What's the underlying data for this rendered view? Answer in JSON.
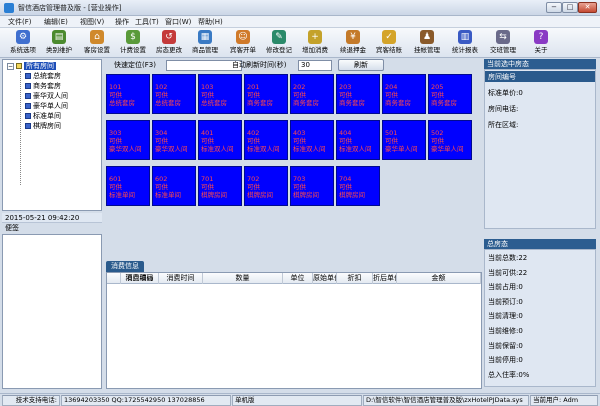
{
  "window": {
    "title": "智信酒店管理普及版 - [营业操作]",
    "controls": {
      "minimize": "−",
      "maximize": "□",
      "close": "✕"
    }
  },
  "menu": [
    "文件(F)",
    "编辑(E)",
    "视图(V)",
    "操作",
    "工具(T)",
    "窗口(W)",
    "帮助(H)"
  ],
  "toolbar": [
    {
      "label": "系统选项",
      "icon": "settings-icon",
      "color": "#3f6fcf",
      "glyph": "⚙"
    },
    {
      "label": "类别维护",
      "icon": "category-icon",
      "color": "#4b8a2e",
      "glyph": "▤"
    },
    {
      "label": "客房设置",
      "icon": "room-setup-icon",
      "color": "#d0892b",
      "glyph": "⌂"
    },
    {
      "label": "计费设置",
      "icon": "billing-icon",
      "color": "#5a9a3a",
      "glyph": "$"
    },
    {
      "label": "房态更改",
      "icon": "room-status-icon",
      "color": "#c43a3a",
      "glyph": "↺"
    },
    {
      "label": "商品管理",
      "icon": "goods-icon",
      "color": "#3a7ac4",
      "glyph": "▦"
    },
    {
      "label": "宾客开单",
      "icon": "checkin-icon",
      "color": "#d07a2a",
      "glyph": "☺"
    },
    {
      "label": "修改登记",
      "icon": "edit-register-icon",
      "color": "#2a8a6a",
      "glyph": "✎"
    },
    {
      "label": "增加消费",
      "icon": "add-consume-icon",
      "color": "#c4a22a",
      "glyph": "+"
    },
    {
      "label": "续退押金",
      "icon": "deposit-icon",
      "color": "#c47a2a",
      "glyph": "¥"
    },
    {
      "label": "宾客结账",
      "icon": "checkout-icon",
      "color": "#d4a42a",
      "glyph": "✓"
    },
    {
      "label": "挂帐管理",
      "icon": "credit-icon",
      "color": "#8a5a2a",
      "glyph": "♟"
    },
    {
      "label": "统计报表",
      "icon": "report-icon",
      "color": "#3a5ac4",
      "glyph": "▥"
    },
    {
      "label": "交班管理",
      "icon": "shift-icon",
      "color": "#6a6a8a",
      "glyph": "⇆"
    },
    {
      "label": "关于",
      "icon": "about-icon",
      "color": "#8a3ac4",
      "glyph": "?"
    }
  ],
  "tree": {
    "root": "所有房间",
    "children": [
      "总统套房",
      "商务套房",
      "豪华双人间",
      "豪华单人间",
      "标准单间",
      "棋牌房间"
    ]
  },
  "datetime": "2015-05-21  09:42:20",
  "memo": {
    "title": "便签"
  },
  "quick": {
    "locate_label": "快速定位(F3)",
    "locate_value": "",
    "refresh_label": "自动刷新时间(秒)",
    "refresh_value": "30",
    "refresh_button": "刷新"
  },
  "rooms": [
    {
      "no": "101",
      "status": "可供",
      "type": "总统套房"
    },
    {
      "no": "102",
      "status": "可供",
      "type": "总统套房"
    },
    {
      "no": "103",
      "status": "可供",
      "type": "总统套房"
    },
    {
      "no": "201",
      "status": "可供",
      "type": "商务套房"
    },
    {
      "no": "202",
      "status": "可供",
      "type": "商务套房"
    },
    {
      "no": "203",
      "status": "可供",
      "type": "商务套房"
    },
    {
      "no": "204",
      "status": "可供",
      "type": "商务套房"
    },
    {
      "no": "205",
      "status": "可供",
      "type": "商务套房"
    },
    {
      "no": "303",
      "status": "可供",
      "type": "豪华双人间"
    },
    {
      "no": "304",
      "status": "可供",
      "type": "豪华双人间"
    },
    {
      "no": "401",
      "status": "可供",
      "type": "标准双人间"
    },
    {
      "no": "402",
      "status": "可供",
      "type": "标准双人间"
    },
    {
      "no": "403",
      "status": "可供",
      "type": "标准双人间"
    },
    {
      "no": "404",
      "status": "可供",
      "type": "标准双人间"
    },
    {
      "no": "501",
      "status": "可供",
      "type": "豪华单人间"
    },
    {
      "no": "502",
      "status": "可供",
      "type": "豪华单人间"
    },
    {
      "no": "601",
      "status": "可供",
      "type": "标准单间"
    },
    {
      "no": "602",
      "status": "可供",
      "type": "标准单间"
    },
    {
      "no": "701",
      "status": "可供",
      "type": "棋牌房间"
    },
    {
      "no": "702",
      "status": "可供",
      "type": "棋牌房间"
    },
    {
      "no": "703",
      "status": "可供",
      "type": "棋牌房间"
    },
    {
      "no": "704",
      "status": "可供",
      "type": "棋牌房间"
    }
  ],
  "consume": {
    "tab": "消费信息",
    "columns": [
      "项目编码",
      "消费项目",
      "消费时间",
      "数量",
      "单位",
      "原始单价",
      "折扣",
      "折后单价",
      "金额"
    ]
  },
  "current_room": {
    "title": "当前选中房态",
    "rows": [
      "房间编号",
      "标准单价:0",
      "房间电话:",
      "所在区域:"
    ]
  },
  "totals": {
    "title": "总房态",
    "rows": [
      "当前总数:22",
      "当前可供:22",
      "当前占用:0",
      "当前预订:0",
      "当前清理:0",
      "当前维修:0",
      "当前保留:0",
      "当前停用:0",
      "总入住率:0%"
    ]
  },
  "status": {
    "support_label": "技术支持电话:",
    "support_phones": "13694203350  QQ:1725542950  137028856",
    "mode": "单机版",
    "db_path": "D:\\智信软件\\智信酒店管理普及版\\zxHotelPJData.sys",
    "user": "当前用户: Adm"
  }
}
